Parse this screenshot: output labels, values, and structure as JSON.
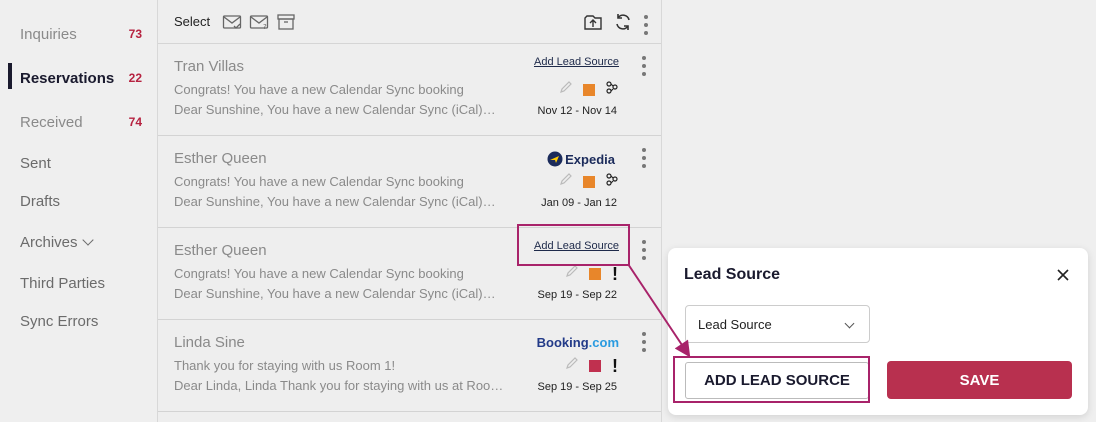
{
  "sidebar": {
    "items": [
      {
        "label": "Inquiries",
        "count": "73"
      },
      {
        "label": "Reservations",
        "count": "22"
      },
      {
        "label": "Received",
        "count": "74"
      },
      {
        "label": "Sent"
      },
      {
        "label": "Drafts"
      },
      {
        "label": "Archives"
      },
      {
        "label": "Third Parties"
      },
      {
        "label": "Sync Errors"
      }
    ]
  },
  "toolbar": {
    "select_label": "Select"
  },
  "messages": [
    {
      "name": "Tran Villas",
      "subject": "Congrats! You have a new Calendar Sync booking",
      "preview": "Dear Sunshine, You have a new Calendar Sync (iCal)…",
      "source": "Add Lead Source",
      "dates": "Nov 12 - Nov 14",
      "status_color": "#e8862a"
    },
    {
      "name": "Esther Queen",
      "subject": "Congrats! You have a new Calendar Sync booking",
      "preview": "Dear Sunshine, You have a new Calendar Sync (iCal)…",
      "source": "Expedia",
      "dates": "Jan 09 - Jan 12",
      "status_color": "#e8862a"
    },
    {
      "name": "Esther Queen",
      "subject": "Congrats! You have a new Calendar Sync booking",
      "preview": "Dear Sunshine, You have a new Calendar Sync (iCal)…",
      "source": "Add Lead Source",
      "dates": "Sep 19 - Sep 22",
      "status_color": "#e8862a"
    },
    {
      "name": "Linda Sine",
      "subject": "Thank you for staying with us Room 1!",
      "preview": "Dear Linda, Linda   Thank you for staying with us at Roo…",
      "source_brand": "Booking",
      "source_tld": ".com",
      "dates": "Sep 19 - Sep 25",
      "status_color": "#c0304f"
    }
  ],
  "popup": {
    "title": "Lead Source",
    "select_value": "Lead Source",
    "add_button": "ADD LEAD SOURCE",
    "save_button": "SAVE"
  },
  "colors": {
    "accent": "#b8304f",
    "highlight": "#a8236a"
  }
}
